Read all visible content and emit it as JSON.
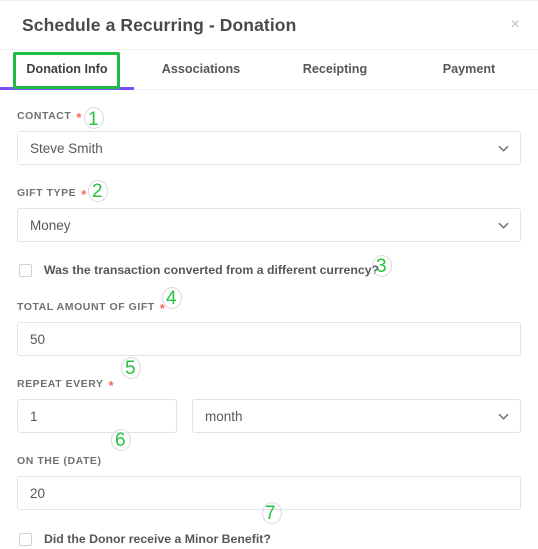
{
  "dialog": {
    "title": "Schedule a Recurring - Donation",
    "close_icon": "close-icon",
    "close_label": "×"
  },
  "tabs": [
    {
      "label": "Donation Info",
      "active": true
    },
    {
      "label": "Associations",
      "active": false
    },
    {
      "label": "Receipting",
      "active": false
    },
    {
      "label": "Payment",
      "active": false
    }
  ],
  "form": {
    "contact": {
      "label": "CONTACT",
      "required_marker": "*",
      "value": "Steve Smith"
    },
    "gift_type": {
      "label": "GIFT TYPE",
      "required_marker": "*",
      "value": "Money"
    },
    "converted_currency": {
      "label": "Was the transaction converted from a different currency?",
      "checked": false
    },
    "total_amount": {
      "label": "TOTAL AMOUNT OF GIFT",
      "required_marker": "*",
      "value": "50"
    },
    "repeat_every": {
      "label": "REPEAT EVERY",
      "required_marker": "*",
      "count_value": "1",
      "unit_value": "month"
    },
    "on_the_date": {
      "label": "ON THE (DATE)",
      "value": "20"
    },
    "minor_benefit": {
      "label": "Did the Donor receive a Minor Benefit?",
      "checked": false
    }
  },
  "annotations": {
    "highlight_target": "Donation Info",
    "numbers": [
      "1",
      "2",
      "3",
      "4",
      "5",
      "6",
      "7"
    ],
    "colors": {
      "green": "#22bb44",
      "purple_accent": "#7c4dff",
      "required_red": "#f26b5b"
    }
  }
}
